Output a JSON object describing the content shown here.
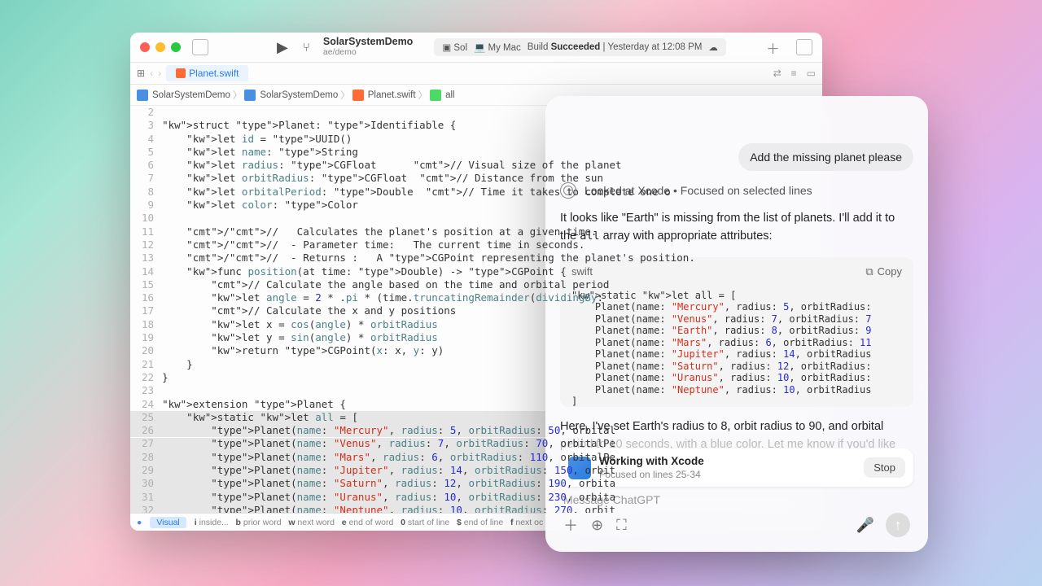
{
  "titlebar": {
    "project": "SolarSystemDemo",
    "branch": "ae/demo",
    "scheme_short": "Sol",
    "device": "My Mac",
    "build_prefix": "Build",
    "build_state": "Succeeded",
    "build_time": "| Yesterday at 12:08 PM"
  },
  "tab": {
    "file": "Planet.swift"
  },
  "crumbs": {
    "a": "SolarSystemDemo",
    "b": "SolarSystemDemo",
    "c": "Planet.swift",
    "d": "all"
  },
  "code": {
    "first_line_no": 2,
    "lines": [
      "",
      "struct Planet: Identifiable {",
      "    let id = UUID()",
      "    let name: String",
      "    let radius: CGFloat      // Visual size of the planet",
      "    let orbitRadius: CGFloat  // Distance from the sun",
      "    let orbitalPeriod: Double  // Time it takes to complete one o",
      "    let color: Color",
      "",
      "    ///   Calculates the planet's position at a given time.",
      "    ///  - Parameter time:   The current time in seconds.",
      "    ///  - Returns :   A CGPoint representing the planet's position.",
      "    func position(at time: Double) -> CGPoint {",
      "        // Calculate the angle based on the time and orbital period",
      "        let angle = 2 * .pi * (time.truncatingRemainder(dividingBy:",
      "        // Calculate the x and y positions",
      "        let x = cos(angle) * orbitRadius",
      "        let y = sin(angle) * orbitRadius",
      "        return CGPoint(x: x, y: y)",
      "    }",
      "}",
      "",
      "extension Planet {",
      "    static let all = [",
      "        Planet(name: \"Mercury\", radius: 5, orbitRadius: 50, orbital",
      "        Planet(name: \"Venus\", radius: 7, orbitRadius: 70, orbitalPe",
      "        Planet(name: \"Mars\", radius: 6, orbitRadius: 110, orbitalPe",
      "        Planet(name: \"Jupiter\", radius: 14, orbitRadius: 150, orbit",
      "        Planet(name: \"Saturn\", radius: 12, orbitRadius: 190, orbita",
      "        Planet(name: \"Uranus\", radius: 10, orbitRadius: 230, orbita",
      "        Planet(name: \"Neptune\", radius: 10, orbitRadius: 270, orbit"
    ],
    "highlight_start": 25,
    "highlight_end": 33
  },
  "bottombar": {
    "mode": "Visual",
    "hints": [
      {
        "k": "i",
        "t": "inside..."
      },
      {
        "k": "b",
        "t": "prior word"
      },
      {
        "k": "w",
        "t": "next word"
      },
      {
        "k": "e",
        "t": "end of word"
      },
      {
        "k": "0",
        "t": "start of line"
      },
      {
        "k": "$",
        "t": "end of line"
      },
      {
        "k": "f",
        "t": "next oc"
      }
    ]
  },
  "chat": {
    "user": "Add the missing planet please",
    "sys": "Looked at Xcode • Focused on selected lines",
    "assist_1a": "It looks like \"Earth\" is missing from the list of planets. I'll add it to the ",
    "assist_1_code": "all",
    "assist_1b": " array with appropriate attributes:",
    "code_lang": "swift",
    "copy": "Copy",
    "code_lines": [
      "static let all = [",
      "    Planet(name: \"Mercury\", radius: 5, orbitRadius:",
      "    Planet(name: \"Venus\", radius: 7, orbitRadius: 7",
      "    Planet(name: \"Earth\", radius: 8, orbitRadius: 9",
      "    Planet(name: \"Mars\", radius: 6, orbitRadius: 11",
      "    Planet(name: \"Jupiter\", radius: 14, orbitRadius",
      "    Planet(name: \"Saturn\", radius: 12, orbitRadius:",
      "    Planet(name: \"Uranus\", radius: 10, orbitRadius:",
      "    Planet(name: \"Neptune\", radius: 10, orbitRadius",
      "]"
    ],
    "assist_2": "Here, I've set Earth's radius to 8, orbit radius to 90, and orbital",
    "assist_2_fade": "period to 10 seconds, with a blue color. Let me know if you'd like",
    "context_title": "Working with Xcode",
    "context_sub": "Focused on lines 25-34",
    "stop": "Stop",
    "placeholder": "Message ChatGPT"
  }
}
